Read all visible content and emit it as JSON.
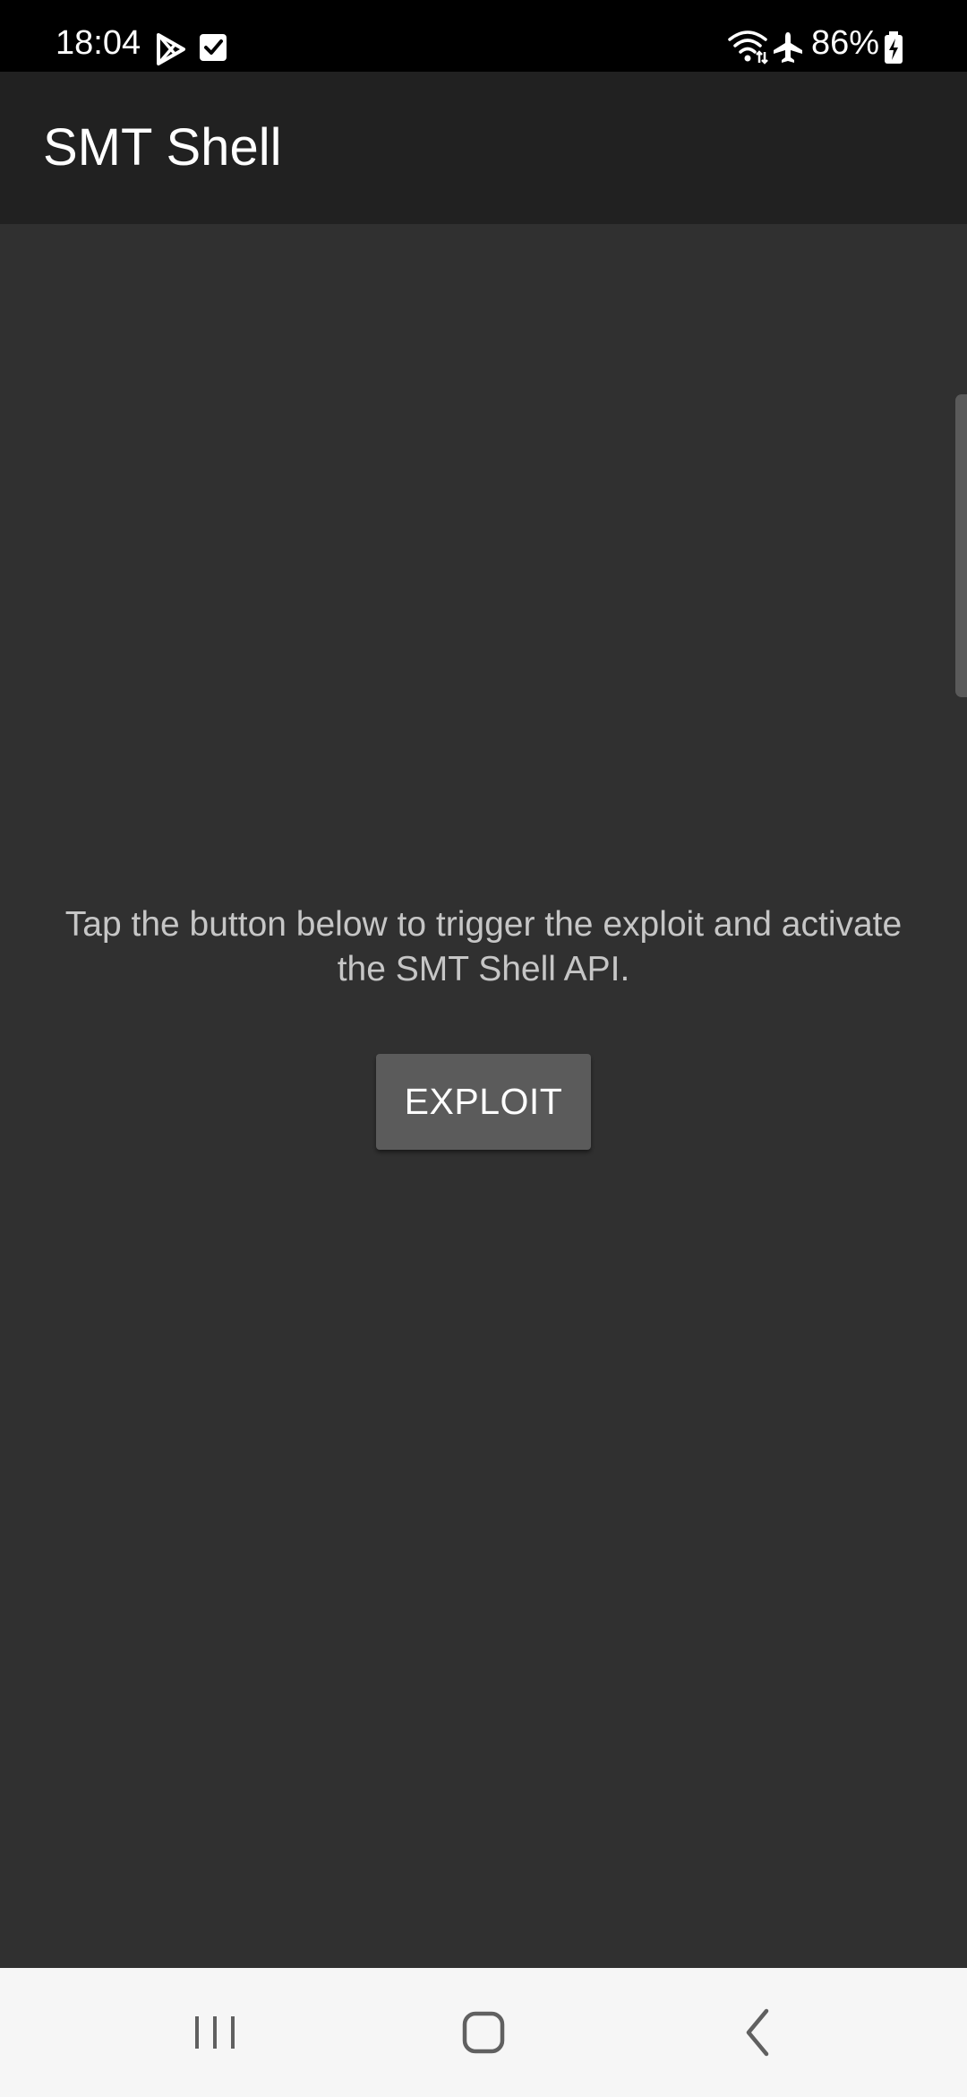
{
  "status_bar": {
    "time": "18:04",
    "battery_percent": "86%",
    "left_icons": [
      "play-store-icon",
      "checkbox-notification-icon"
    ],
    "right_icons": [
      "wifi-icon",
      "airplane-mode-icon",
      "battery-charging-icon"
    ]
  },
  "app_bar": {
    "title": "SMT Shell"
  },
  "main": {
    "message": "Tap the button below to trigger the exploit and activate the SMT Shell API.",
    "exploit_button_label": "EXPLOIT"
  },
  "nav_bar": {
    "buttons": [
      "recent-apps-icon",
      "home-icon",
      "back-icon"
    ]
  },
  "colors": {
    "status_bar_bg": "#000000",
    "app_bar_bg": "#212121",
    "content_bg": "#303030",
    "button_bg": "#5b5b5b",
    "nav_bar_bg": "#f6f6f6"
  }
}
